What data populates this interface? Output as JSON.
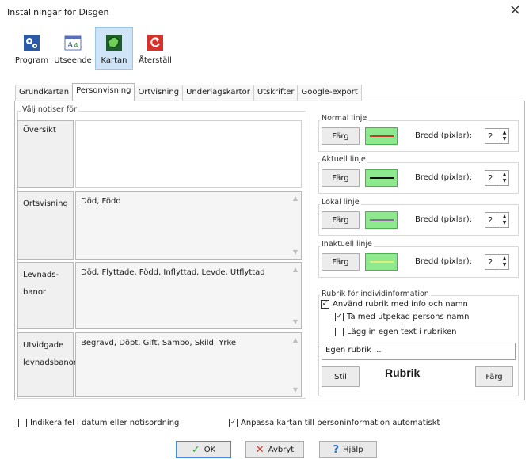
{
  "window": {
    "title": "Inställningar för Disgen",
    "close_glyph": "×"
  },
  "toolbar": [
    {
      "label": "Program",
      "icon": "gears-icon"
    },
    {
      "label": "Utseende",
      "icon": "appearance-icon"
    },
    {
      "label": "Kartan",
      "icon": "map-icon",
      "active": true
    },
    {
      "label": "Återställ",
      "icon": "reset-icon"
    }
  ],
  "tabs": [
    "Grundkartan",
    "Personvisning",
    "Ortvisning",
    "Underlagskartor",
    "Utskrifter",
    "Google-export"
  ],
  "active_tab": "Personvisning",
  "notices": {
    "group_title": "Välj notiser för",
    "rows": [
      {
        "label": "Översikt",
        "value": ""
      },
      {
        "label": "Ortsvisning",
        "value": "Död, Född"
      },
      {
        "label": "Levnads-\n\nbanor",
        "value": "Död, Flyttade, Född, Inflyttad, Levde, Utflyttad"
      },
      {
        "label": "Utvidgade\n\nlevnadsbanor",
        "value": "Begravd, Döpt, Gift, Sambo, Skild, Yrke"
      }
    ]
  },
  "lines": [
    {
      "title": "Normal linje",
      "color_button": "Färg",
      "width_label": "Bredd (pixlar):",
      "width": "2",
      "line_color": "#c0392b"
    },
    {
      "title": "Aktuell linje",
      "color_button": "Färg",
      "width_label": "Bredd (pixlar):",
      "width": "2",
      "line_color": "#111111"
    },
    {
      "title": "Lokal linje",
      "color_button": "Färg",
      "width_label": "Bredd (pixlar):",
      "width": "2",
      "line_color": "#8e6b9e"
    },
    {
      "title": "Inaktuell linje",
      "color_button": "Färg",
      "width_label": "Bredd (pixlar):",
      "width": "2",
      "line_color": "#d8f27a"
    }
  ],
  "rubrik": {
    "group_title": "Rubrik för individinformation",
    "use_heading": {
      "label": "Använd rubrik med info och namn",
      "checked": true
    },
    "include_person": {
      "label": "Ta med utpekad persons namn",
      "checked": true
    },
    "own_text": {
      "label": "Lägg in egen text i rubriken",
      "checked": false
    },
    "input_placeholder": "Egen rubrik ...",
    "style_button": "Stil",
    "preview": "Rubrik",
    "color_button": "Färg"
  },
  "bottom_options": {
    "indicate_errors": {
      "label": "Indikera fel i datum eller notisordning",
      "checked": false
    },
    "adapt_map": {
      "label": "Anpassa kartan till personinformation automatiskt",
      "checked": true
    }
  },
  "dialog_buttons": {
    "ok": "OK",
    "cancel": "Avbryt",
    "help": "Hjälp"
  },
  "colors": {
    "accent": "#3c8ee2",
    "swatch_bg": "#8ee88e",
    "active_tool_bg": "#cfe4f7"
  }
}
